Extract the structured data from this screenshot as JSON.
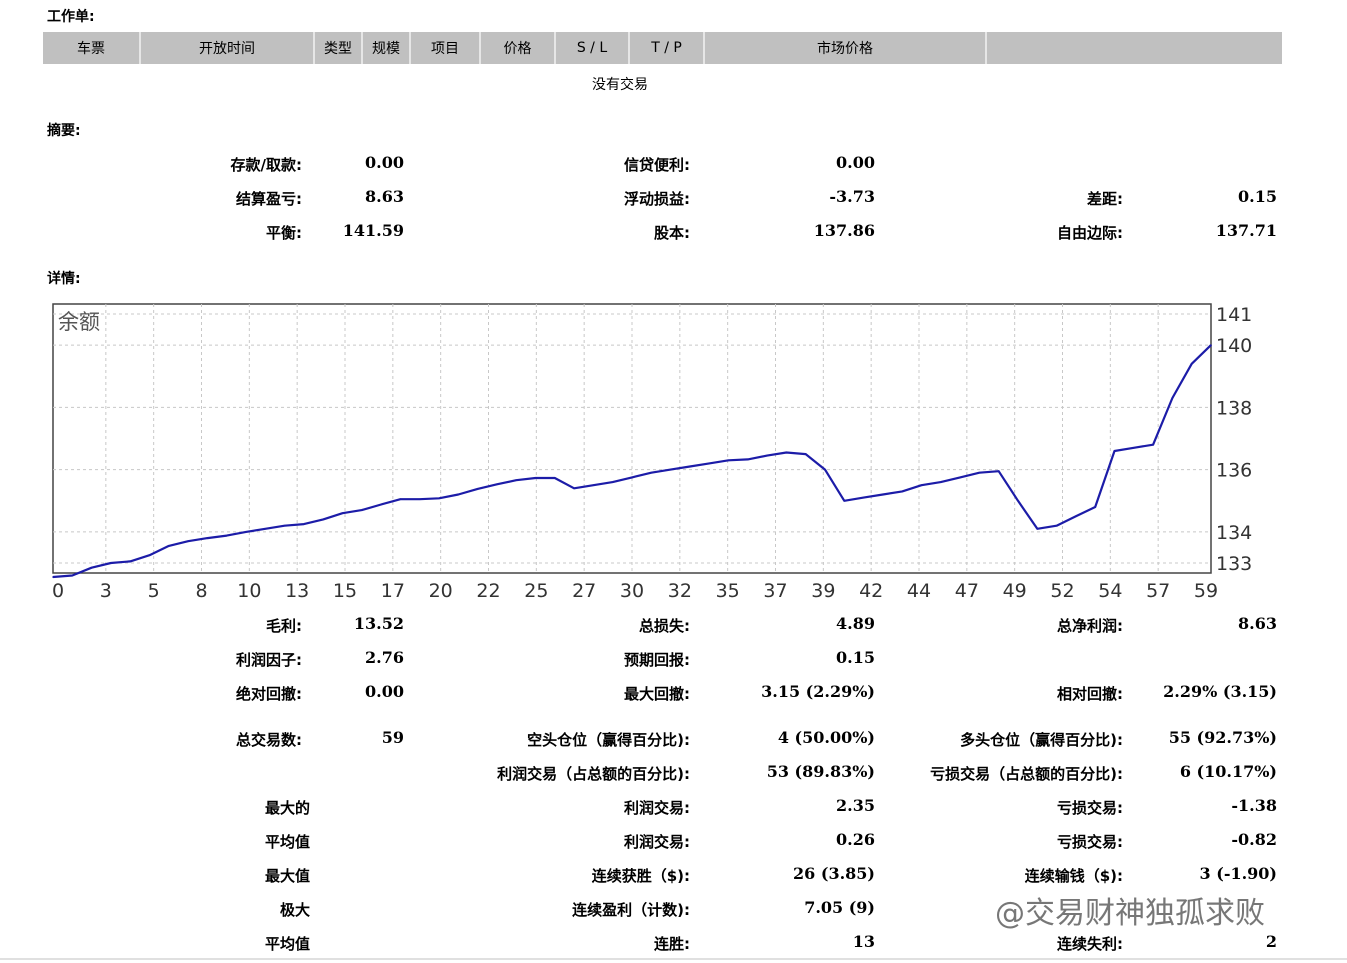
{
  "orders": {
    "title": "工作单:",
    "columns": [
      "车票",
      "开放时间",
      "类型",
      "规模",
      "项目",
      "价格",
      "S / L",
      "T / P",
      "市场价格",
      ""
    ],
    "empty_text": "没有交易"
  },
  "summary": {
    "title": "摘要:",
    "deposit_label": "存款/取款:",
    "deposit_value": "0.00",
    "credit_label": "信贷便利:",
    "credit_value": "0.00",
    "closed_pl_label": "结算盈亏:",
    "closed_pl_value": "8.63",
    "floating_pl_label": "浮动损益:",
    "floating_pl_value": "-3.73",
    "spread_label": "差距:",
    "spread_value": "0.15",
    "balance_label": "平衡:",
    "balance_value": "141.59",
    "equity_label": "股本:",
    "equity_value": "137.86",
    "free_margin_label": "自由边际:",
    "free_margin_value": "137.71"
  },
  "details": {
    "title": "详情:",
    "rows": [
      {
        "l1": "毛利:",
        "v1": "13.52",
        "l2": "总损失:",
        "v2": "4.89",
        "l3": "总净利润:",
        "v3": "8.63"
      },
      {
        "l1": "利润因子:",
        "v1": "2.76",
        "l2": "预期回报:",
        "v2": "0.15",
        "l3": "",
        "v3": ""
      },
      {
        "l1": "绝对回撤:",
        "v1": "0.00",
        "l2": "最大回撤:",
        "v2": "3.15 (2.29%)",
        "l3": "相对回撤:",
        "v3": "2.29% (3.15)"
      },
      {
        "l1": "总交易数:",
        "v1": "59",
        "l2": "空头仓位（赢得百分比):",
        "v2": "4 (50.00%)",
        "l3": "多头仓位（赢得百分比):",
        "v3": "55 (92.73%)"
      },
      {
        "l1": "",
        "v1": "",
        "l2": "利润交易（占总额的百分比):",
        "v2": "53 (89.83%)",
        "l3": "亏损交易（占总额的百分比):",
        "v3": "6 (10.17%)"
      },
      {
        "l1": "最大的",
        "v1": "",
        "l2": "利润交易:",
        "v2": "2.35",
        "l3": "亏损交易:",
        "v3": "-1.38"
      },
      {
        "l1": "平均值",
        "v1": "",
        "l2": "利润交易:",
        "v2": "0.26",
        "l3": "亏损交易:",
        "v3": "-0.82"
      },
      {
        "l1": "最大值",
        "v1": "",
        "l2": "连续获胜（$):",
        "v2": "26 (3.85)",
        "l3": "连续输钱（$):",
        "v3": "3 (-1.90)"
      },
      {
        "l1": "极大",
        "v1": "",
        "l2": "连续盈利（计数):",
        "v2": "7.05 (9)",
        "l3": "",
        "v3": ""
      },
      {
        "l1": "平均值",
        "v1": "",
        "l2": "连胜:",
        "v2": "13",
        "l3": "连续失利:",
        "v3": "2"
      }
    ]
  },
  "watermark": "@交易财神独孤求败",
  "chart_data": {
    "type": "line",
    "title": "余额",
    "color": "#1c1ca8",
    "x_ticks": [
      "0",
      "3",
      "5",
      "8",
      "10",
      "13",
      "15",
      "17",
      "20",
      "22",
      "25",
      "27",
      "30",
      "32",
      "35",
      "37",
      "39",
      "42",
      "44",
      "47",
      "49",
      "52",
      "54",
      "57",
      "59"
    ],
    "y_ticks": [
      "133",
      "134",
      "136",
      "138",
      "140",
      "141"
    ],
    "ylim": [
      133,
      141
    ],
    "xlim": [
      0,
      60
    ],
    "series": [
      {
        "x": [
          0,
          1,
          2,
          3,
          4,
          5,
          6,
          7,
          8,
          9,
          10,
          11,
          12,
          13,
          14,
          15,
          16,
          17,
          18,
          19,
          20,
          21,
          22,
          23,
          24,
          25,
          26,
          27,
          28,
          29,
          30,
          31,
          32,
          33,
          34,
          35,
          36,
          37,
          38,
          39,
          40,
          41,
          42,
          43,
          44,
          45,
          46,
          47,
          48,
          49,
          50,
          51,
          52,
          53,
          54,
          55,
          56,
          57,
          58,
          59,
          60
        ],
        "values": [
          132.55,
          132.6,
          132.85,
          133.0,
          133.05,
          133.25,
          133.55,
          133.7,
          133.8,
          133.88,
          134.0,
          134.1,
          134.2,
          134.25,
          134.4,
          134.6,
          134.7,
          134.88,
          135.05,
          135.05,
          135.08,
          135.2,
          135.38,
          135.53,
          135.66,
          135.73,
          135.73,
          135.4,
          135.5,
          135.6,
          135.75,
          135.9,
          136.0,
          136.1,
          136.2,
          136.3,
          136.33,
          136.45,
          136.55,
          136.5,
          136.0,
          135.0,
          135.1,
          135.2,
          135.3,
          135.5,
          135.6,
          135.75,
          135.9,
          135.95,
          135.0,
          134.1,
          134.2,
          134.5,
          134.8,
          136.6,
          136.7,
          136.8,
          138.3,
          139.4,
          140.0
        ]
      }
    ]
  }
}
